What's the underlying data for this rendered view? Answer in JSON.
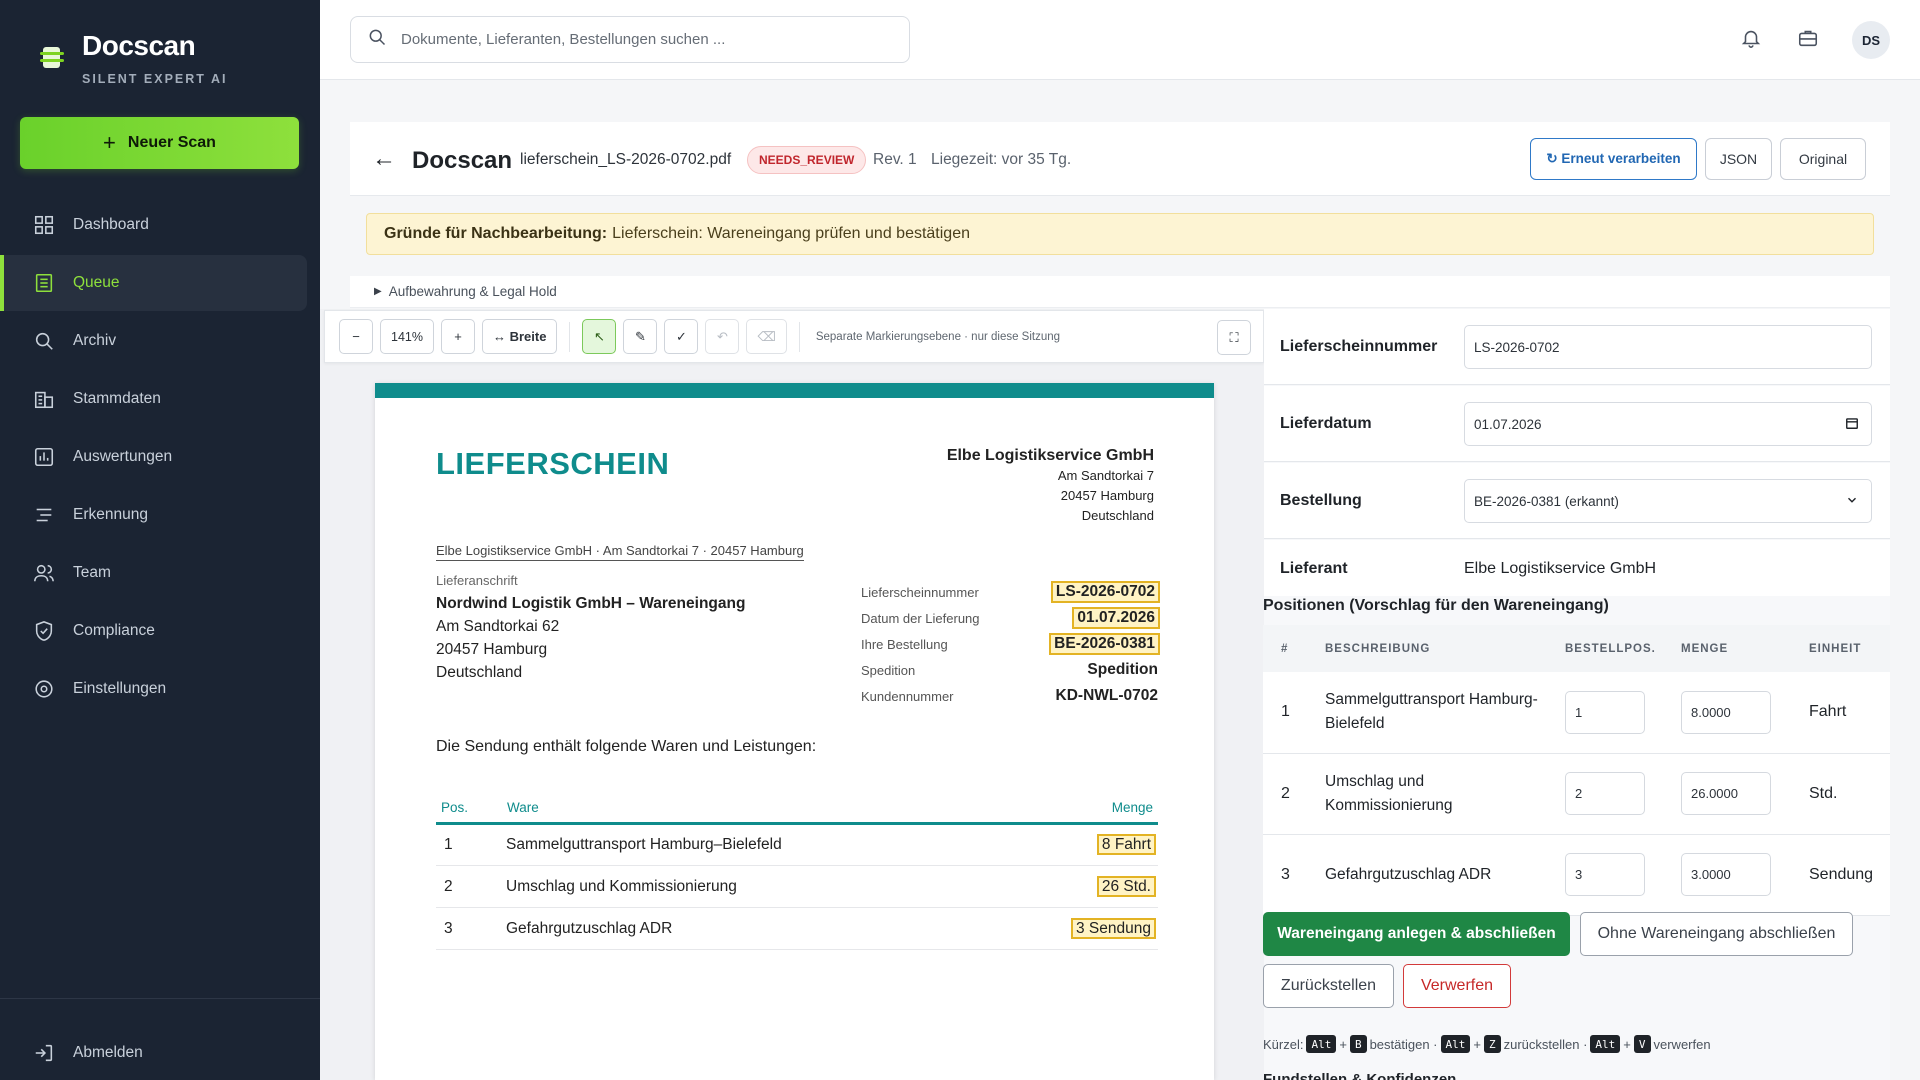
{
  "app": {
    "brand": "Docscan",
    "tagline": "SILENT EXPERT AI",
    "new_scan": "Neuer Scan",
    "nav": [
      {
        "label": "Dashboard",
        "icon": "grid-icon"
      },
      {
        "label": "Queue",
        "icon": "list-icon",
        "active": true
      },
      {
        "label": "Archiv",
        "icon": "search-icon"
      },
      {
        "label": "Stammdaten",
        "icon": "building-icon"
      },
      {
        "label": "Auswertungen",
        "icon": "chart-icon"
      },
      {
        "label": "Erkennung",
        "icon": "filter-icon"
      },
      {
        "label": "Team",
        "icon": "users-icon"
      },
      {
        "label": "Compliance",
        "icon": "shield-icon"
      },
      {
        "label": "Einstellungen",
        "icon": "gear-icon"
      }
    ],
    "logout": "Abmelden",
    "accent": "#8ee03c",
    "sidebar_bg": "#1b2433"
  },
  "topbar": {
    "search_placeholder": "Dokumente, Lieferanten, Bestellungen suchen ...",
    "avatar": "DS"
  },
  "header": {
    "title": "Docscan",
    "file": "lieferschein_LS-2026-0702.pdf",
    "status": "NEEDS_REVIEW",
    "rev": "Rev. 1",
    "liegezeit": "Liegezeit: vor 35 Tg.",
    "btn_reprocess": "↻ Erneut verarbeiten",
    "btn_json": "JSON",
    "btn_original": "Original"
  },
  "warning": {
    "label": "Gründe für Nachbearbeitung:",
    "text": "Lieferschein: Wareneingang prüfen und bestätigen"
  },
  "retention": "Aufbewahrung & Legal Hold",
  "toolbar": {
    "minus": "−",
    "zoom": "141%",
    "plus": "+",
    "width": "↔ Breite",
    "select": "↖",
    "pen": "✎",
    "check": "✓",
    "undo": "↶",
    "erase": "⌫",
    "note": "Separate Markierungsebene · nur diese Sitzung",
    "fullscreen": "⛶"
  },
  "document": {
    "title": "LIEFERSCHEIN",
    "sender_name": "Elbe Logistikservice GmbH",
    "sender_street": "Am Sandtorkai 7",
    "sender_city": "20457 Hamburg",
    "sender_country": "Deutschland",
    "return_line": "Elbe Logistikservice GmbH · Am Sandtorkai 7 · 20457 Hamburg",
    "recipient_label": "Lieferanschrift",
    "recipient_name": "Nordwind Logistik GmbH – Wareneingang",
    "recipient_street": "Am Sandtorkai 62",
    "recipient_city": "20457 Hamburg",
    "recipient_country": "Deutschland",
    "meta": [
      {
        "k": "Lieferscheinnummer",
        "v": "LS-2026-0702",
        "hl": true
      },
      {
        "k": "Datum der Lieferung",
        "v": "01.07.2026",
        "hl": true
      },
      {
        "k": "Ihre Bestellung",
        "v": "BE-2026-0381",
        "hl": true
      },
      {
        "k": "Spedition",
        "v": "Spedition",
        "hl": false
      },
      {
        "k": "Kundennummer",
        "v": "KD-NWL-0702",
        "hl": false
      }
    ],
    "intro": "Die Sendung enthält folgende Waren und Leistungen:",
    "col_pos": "Pos.",
    "col_ware": "Ware",
    "col_menge": "Menge",
    "rows": [
      {
        "pos": "1",
        "ware": "Sammelguttransport Hamburg–Bielefeld",
        "menge": "8 Fahrt"
      },
      {
        "pos": "2",
        "ware": "Umschlag und Kommissionierung",
        "menge": "26 Std."
      },
      {
        "pos": "3",
        "ware": "Gefahrgutzuschlag ADR",
        "menge": "3 Sendung"
      }
    ]
  },
  "form": {
    "lieferscheinnummer_label": "Lieferscheinnummer",
    "lieferscheinnummer": "LS-2026-0702",
    "lieferdatum_label": "Lieferdatum",
    "lieferdatum": "01.07.2026",
    "bestellung_label": "Bestellung",
    "bestellung": "BE-2026-0381 (erkannt)",
    "lieferant_label": "Lieferant",
    "lieferant": "Elbe Logistikservice GmbH",
    "positions_title": "Positionen (Vorschlag für den Wareneingang)",
    "cols": [
      "#",
      "BESCHREIBUNG",
      "BESTELLPOS.",
      "MENGE",
      "EINHEIT"
    ],
    "items": [
      {
        "n": "1",
        "desc": "Sammelguttransport Hamburg-Bielefeld",
        "bestellpos": "1",
        "menge": "8.0000",
        "einheit": "Fahrt"
      },
      {
        "n": "2",
        "desc": "Umschlag und Kommissionierung",
        "bestellpos": "2",
        "menge": "26.0000",
        "einheit": "Std."
      },
      {
        "n": "3",
        "desc": "Gefahrgutzuschlag ADR",
        "bestellpos": "3",
        "menge": "3.0000",
        "einheit": "Sendung"
      }
    ],
    "btn_create": "Wareneingang anlegen & abschließen",
    "btn_without": "Ohne Wareneingang abschließen",
    "btn_defer": "Zurückstellen",
    "btn_reject": "Verwerfen",
    "shortcuts": {
      "prefix": "Kürzel:",
      "alt": "Alt",
      "plus": "+",
      "k1": "B",
      "t1": "bestätigen ·",
      "k2": "Z",
      "t2": "zurückstellen ·",
      "k3": "V",
      "t3": "verwerfen"
    },
    "fundstellen": "Fundstellen & Konfidenzen"
  }
}
